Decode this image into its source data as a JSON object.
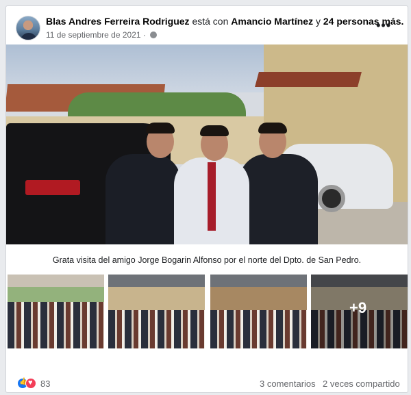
{
  "post": {
    "author": "Blas Andres Ferreira Rodriguez",
    "connector": "está con",
    "tagged_person": "Amancio Martínez",
    "and_word": "y",
    "others": "24 personas más.",
    "date": "11 de septiembre de 2021",
    "date_separator": "·",
    "more_label": "•••",
    "caption": "Grata visita del amigo Jorge Bogarin Alfonso por el norte del Dpto. de San Pedro.",
    "extra_photos_label": "+9"
  },
  "reactions": {
    "count": "83",
    "comments": "3 comentarios",
    "shares": "2 veces compartido"
  },
  "icons": {
    "privacy": "globe-icon",
    "like": "like-icon",
    "love": "love-icon",
    "more": "more-options-icon"
  }
}
